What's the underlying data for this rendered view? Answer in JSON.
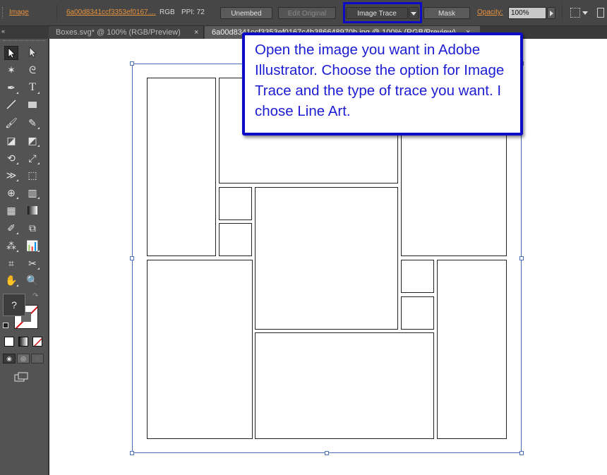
{
  "control_bar": {
    "object_type": "Image",
    "filename_link": "6a00d8341ccf3353ef0167....",
    "color_mode": "RGB",
    "ppi": "PPI: 72",
    "unembed": "Unembed",
    "edit_original": "Edit Original",
    "image_trace": "Image Trace",
    "mask": "Mask",
    "opacity_label": "Opacity:",
    "opacity_value": "100%"
  },
  "tabs": [
    {
      "label": "Boxes.svg* @ 100% (RGB/Preview)"
    },
    {
      "label": "6a00d8341ccf3353ef0167c4b386648970b.jpg @ 100% (RGB/Preview)"
    }
  ],
  "toolbox": {
    "unknown_fill": "?"
  },
  "callout": {
    "text": "Open the image you want in Adobe Illustrator. Choose the option for Image Trace and the type of trace you want. I chose Line Art."
  },
  "colors": {
    "accent_orange": "#e8923c",
    "annotation_blue": "#0c0cc8",
    "selection_blue": "#4a6fb5"
  }
}
